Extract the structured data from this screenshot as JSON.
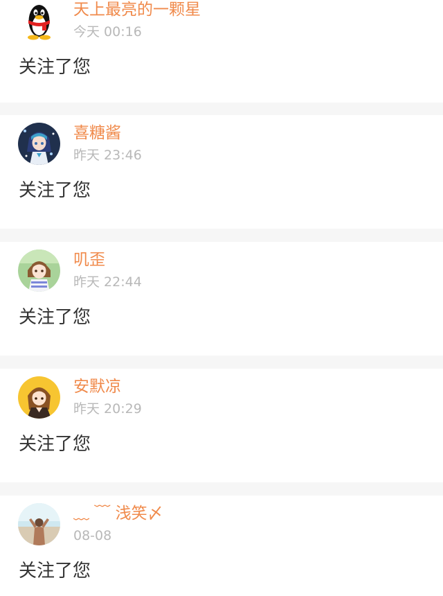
{
  "notifications": [
    {
      "username": "天上最亮的一颗星",
      "time": "今天 00:16",
      "message": "关注了您",
      "avatar_icon": "qq-penguin-icon"
    },
    {
      "username": "喜糖酱",
      "time": "昨天 23:46",
      "message": "关注了您",
      "avatar_icon": "anime-avatar-icon"
    },
    {
      "username": "叽歪",
      "time": "昨天 22:44",
      "message": "关注了您",
      "avatar_icon": "anime-girl-avatar-icon"
    },
    {
      "username": "安默凉",
      "time": "昨天 20:29",
      "message": "关注了您",
      "avatar_icon": "anime-girl-yellow-avatar-icon"
    },
    {
      "username": "﹏ ﹋ 浅笑〆",
      "time": "08-08",
      "message": "关注了您",
      "avatar_icon": "beach-photo-avatar-icon"
    }
  ],
  "colors": {
    "accent": "#f08a4b",
    "secondary_text": "#b8b8b8",
    "primary_text": "#333333",
    "divider": "#f6f6f6",
    "card_background": "#ffffff"
  }
}
